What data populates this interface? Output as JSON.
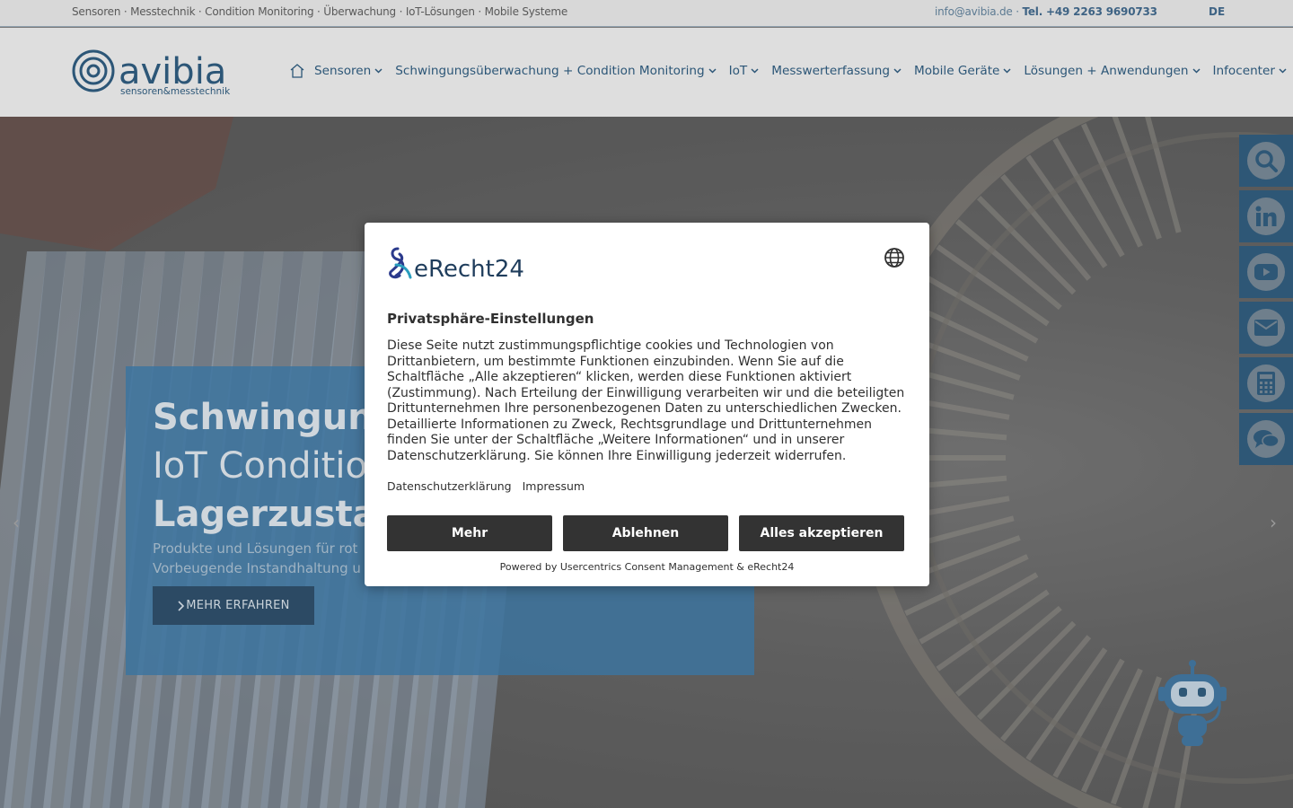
{
  "topbar": {
    "tagline": "Sensoren · Messtechnik · Condition Monitoring · Überwachung · IoT-Lösungen · Mobile Systeme",
    "email": "info@avibia.de",
    "separator": " · ",
    "phone": "Tel. +49 2263 9690733",
    "language": "DE"
  },
  "header": {
    "logo_text": "avibia",
    "logo_subtext": "sensoren&messtechnik",
    "nav": [
      {
        "label": "Sensoren"
      },
      {
        "label": "Schwingungsüberwachung + Condition Monitoring"
      },
      {
        "label": "IoT"
      },
      {
        "label": "Messwerterfassung"
      },
      {
        "label": "Mobile Geräte"
      },
      {
        "label": "Lösungen + Anwendungen"
      },
      {
        "label": "Infocenter"
      }
    ]
  },
  "hero": {
    "title_line1": "Schwingungs",
    "title_line2": "IoT Condition",
    "title_line3": "Lagerzustand",
    "text_line1": "Produkte und Lösungen für rot",
    "text_line2": "Vorbeugende Instandhaltung u",
    "button_label": "MEHR ERFAHREN",
    "prev_arrow": "‹",
    "next_arrow": "›"
  },
  "side_buttons": [
    "search-icon",
    "linkedin-icon",
    "youtube-icon",
    "mail-icon",
    "calculator-icon",
    "chat-icon"
  ],
  "consent": {
    "logo_text": "eRecht24",
    "title": "Privatsphäre-Einstellungen",
    "description": "Diese Seite nutzt zustimmungspflichtige cookies und Technologien von Drittanbietern, um bestimmte Funktionen einzubinden. Wenn Sie auf die Schaltfläche „Alle akzeptieren“ klicken, werden diese Funktionen aktiviert (Zustimmung). Nach Erteilung der Einwilligung verarbeiten wir und die beteiligten Drittunternehmen Ihre personenbezogenen Daten zu unterschiedlichen Zwecken. Detaillierte Informationen zu Zweck, Rechtsgrundlage und Drittunternehmen finden Sie unter der Schaltfläche „Weitere Informationen“ und in unserer Datenschutzerklärung. Sie können Ihre Einwilligung jederzeit widerrufen.",
    "link_privacy": "Datenschutzerklärung",
    "link_imprint": "Impressum",
    "btn_more": "Mehr",
    "btn_decline": "Ablehnen",
    "btn_accept": "Alles akzeptieren",
    "powered_by": "Powered by Usercentrics Consent Management & eRecht24"
  },
  "colors": {
    "brand_blue": "#2c5677",
    "button_dark": "#333333",
    "side_bar": "#2e5776"
  }
}
